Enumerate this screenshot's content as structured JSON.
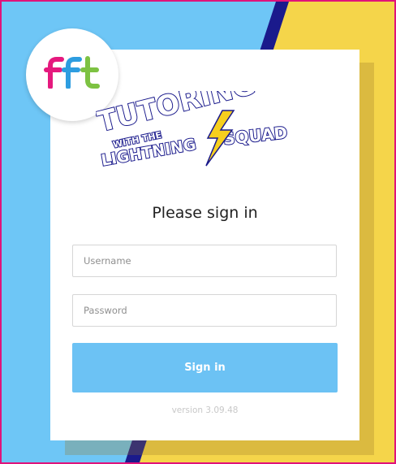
{
  "header": {
    "logo_text": "fft",
    "banner": {
      "line1": "TUTORING",
      "line2": "WITH THE",
      "line3": "LIGHTNING",
      "line4": "SQUAD"
    }
  },
  "login": {
    "title": "Please sign in",
    "username_placeholder": "Username",
    "password_placeholder": "Password",
    "signin_label": "Sign in",
    "version": "version 3.09.48"
  },
  "colors": {
    "blue_bg": "#6ec6f6",
    "yellow_bg": "#f5d54a",
    "navy_stripe": "#1a1a8c",
    "frame": "#e0137a",
    "button": "#6cc2f4",
    "logo_f1": "#e5197e",
    "logo_f2": "#2d9de0",
    "logo_t": "#7dc242"
  },
  "icons": [
    "lightning-bolt-icon"
  ]
}
